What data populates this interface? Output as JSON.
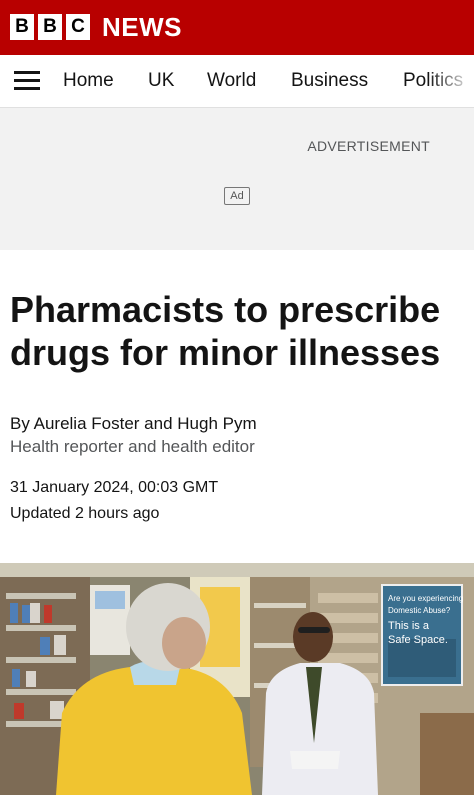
{
  "brand": {
    "blocks": [
      "B",
      "B",
      "C"
    ],
    "news": "NEWS",
    "color": "#b80000"
  },
  "nav": {
    "items": [
      "Home",
      "UK",
      "World",
      "Business",
      "Politics"
    ]
  },
  "ad": {
    "label": "ADVERTISEMENT",
    "badge": "Ad"
  },
  "article": {
    "headline": "Pharmacists to prescribe drugs for minor illnesses",
    "byline": "By Aurelia Foster and Hugh Pym",
    "role": "Health reporter and health editor",
    "date": "31 January 2024, 00:03 GMT",
    "updated": "Updated 2 hours ago"
  },
  "photo": {
    "sign_lines": [
      "Are you experiencing",
      "Domestic Abuse?",
      "This is a",
      "Safe Space."
    ]
  }
}
